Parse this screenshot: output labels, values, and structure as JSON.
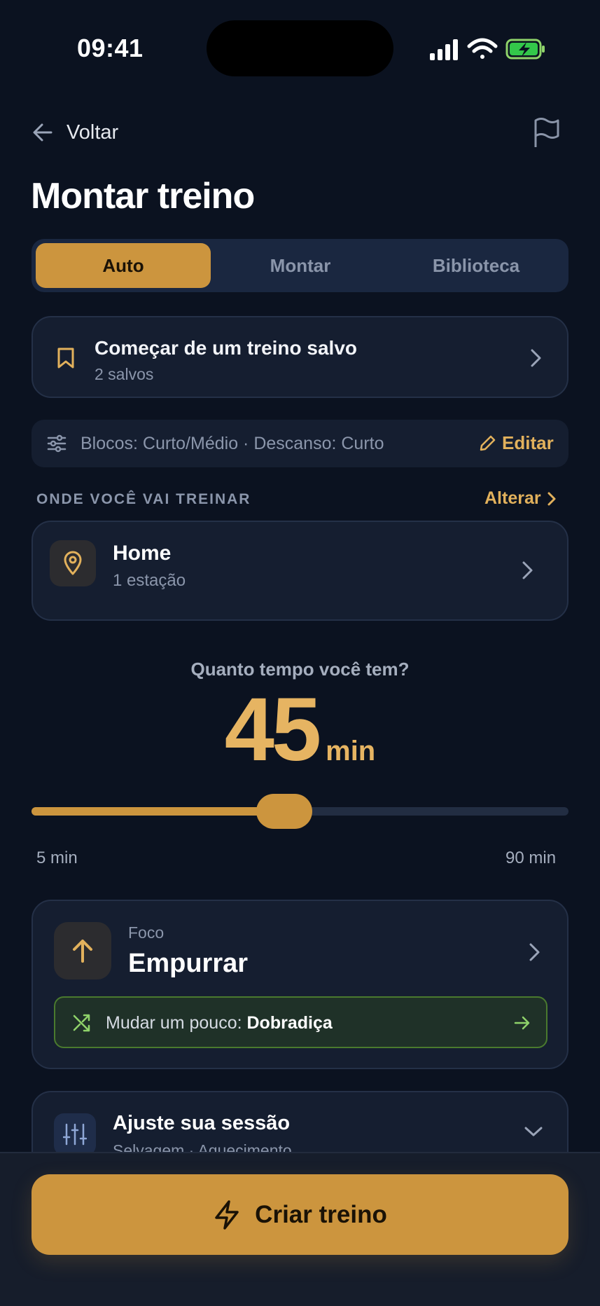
{
  "status_bar": {
    "time": "09:41"
  },
  "header": {
    "back_label": "Voltar",
    "title": "Montar treino"
  },
  "tabs": [
    {
      "label": "Auto",
      "active": true
    },
    {
      "label": "Montar",
      "active": false
    },
    {
      "label": "Biblioteca",
      "active": false
    }
  ],
  "saved": {
    "title": "Começar de um treino salvo",
    "subtitle": "2 salvos"
  },
  "prefs": {
    "summary": "Blocos: Curto/Médio · Descanso: Curto",
    "edit_label": "Editar"
  },
  "location": {
    "section_label": "ONDE VOCÊ VAI TREINAR",
    "change_label": "Alterar",
    "name": "Home",
    "detail": "1 estação"
  },
  "duration": {
    "question": "Quanto tempo você tem?",
    "value": "45",
    "unit": "min",
    "min_label": "5 min",
    "max_label": "90 min",
    "min": 5,
    "max": 90,
    "current": 45
  },
  "focus": {
    "label": "Foco",
    "value": "Empurrar",
    "variety_prefix": "Mudar um pouco:",
    "variety_value": "Dobradiça"
  },
  "adjust": {
    "title": "Ajuste sua sessão",
    "subtitle": "Selvagem · Aquecimento"
  },
  "cta": {
    "label": "Criar treino"
  },
  "colors": {
    "background": "#0b1220",
    "accent": "#cc953e",
    "accent_text": "#e2b15c",
    "card": "#151e30",
    "variety_border": "#4a7a2e"
  }
}
